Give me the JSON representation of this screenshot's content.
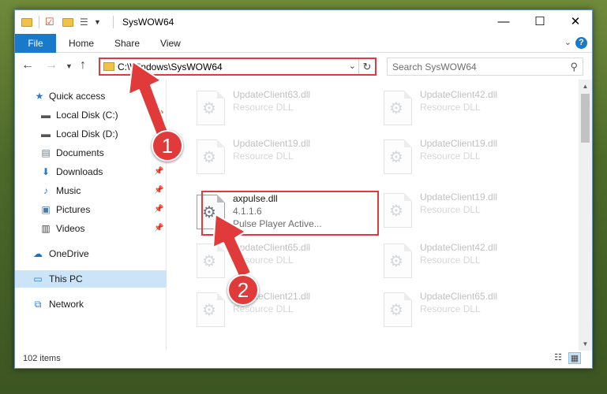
{
  "window": {
    "title": "SysWOW64",
    "minimize_glyph": "—",
    "maximize_glyph": "☐",
    "close_glyph": "✕"
  },
  "ribbon": {
    "file": "File",
    "tabs": [
      "Home",
      "Share",
      "View"
    ]
  },
  "nav": {
    "address": "C:\\Windows\\SysWOW64",
    "search_placeholder": "Search SysWOW64"
  },
  "sidebar": {
    "items": [
      {
        "label": "Quick access",
        "icon": "star-icon"
      },
      {
        "label": "Local Disk (C:)",
        "icon": "drive-icon",
        "pinned": true
      },
      {
        "label": "Local Disk (D:)",
        "icon": "drive-icon",
        "pinned": false
      },
      {
        "label": "Documents",
        "icon": "documents-icon",
        "pinned": false
      },
      {
        "label": "Downloads",
        "icon": "downloads-icon",
        "pinned": true
      },
      {
        "label": "Music",
        "icon": "music-icon",
        "pinned": true
      },
      {
        "label": "Pictures",
        "icon": "pictures-icon",
        "pinned": true
      },
      {
        "label": "Videos",
        "icon": "videos-icon",
        "pinned": true
      },
      {
        "label": "OneDrive",
        "icon": "onedrive-icon"
      },
      {
        "label": "This PC",
        "icon": "this-pc-icon",
        "selected": true
      },
      {
        "label": "Network",
        "icon": "network-icon"
      }
    ]
  },
  "files": {
    "left": [
      {
        "name": "UpdateClient63.dll",
        "type": "Resource DLL"
      },
      {
        "name": "UpdateClient19.dll",
        "type": "Resource DLL"
      },
      {
        "name": "axpulse.dll",
        "version": "4.1.1.6",
        "desc": "Pulse Player Active..."
      },
      {
        "name": "UpdateClient65.dll",
        "type": "Resource DLL"
      },
      {
        "name": "UpdateClient21.dll",
        "type": "Resource DLL"
      }
    ],
    "right": [
      {
        "name": "UpdateClient42.dll",
        "type": "Resource DLL"
      },
      {
        "name": "UpdateClient19.dll",
        "type": "Resource DLL"
      },
      {
        "name": "UpdateClient19.dll",
        "type": "Resource DLL"
      },
      {
        "name": "UpdateClient42.dll",
        "type": "Resource DLL"
      },
      {
        "name": "UpdateClient65.dll",
        "type": "Resource DLL"
      }
    ]
  },
  "status": {
    "count": "102 items"
  },
  "annotations": {
    "step1": "1",
    "step2": "2",
    "color": "#e03a3a"
  },
  "colors": {
    "accent": "#1979ca",
    "selected": "#cce4f7"
  }
}
